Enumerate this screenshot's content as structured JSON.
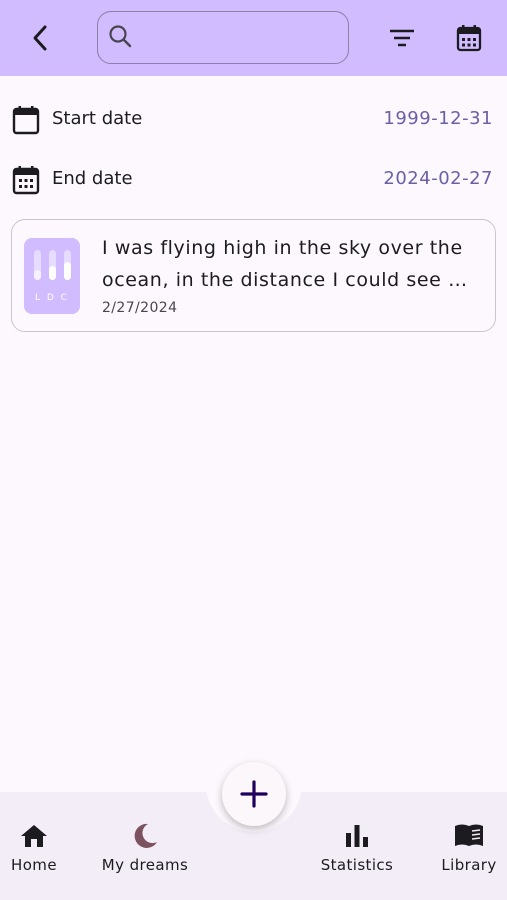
{
  "search": {
    "placeholder": "",
    "value": ""
  },
  "dates": {
    "start_label": "Start date",
    "start_value": "1999-12-31",
    "end_label": "End date",
    "end_value": "2024-02-27"
  },
  "dreams": [
    {
      "text": "I was flying high in the sky over the ocean, in the distance I could see …",
      "date": "2/27/2024",
      "thumb_letters": "L D C"
    }
  ],
  "nav": {
    "home": "Home",
    "my_dreams": "My dreams",
    "statistics": "Statistics",
    "library": "Library"
  },
  "icons": {
    "back": "arrow-back-icon",
    "search": "search-icon",
    "filter": "filter-icon",
    "calendar": "calendar-icon",
    "add": "plus-icon"
  },
  "colors": {
    "topbar": "#d0bcff",
    "date_value": "#6b5fa6",
    "moon": "#7d5260",
    "fab_plus": "#21005d"
  }
}
